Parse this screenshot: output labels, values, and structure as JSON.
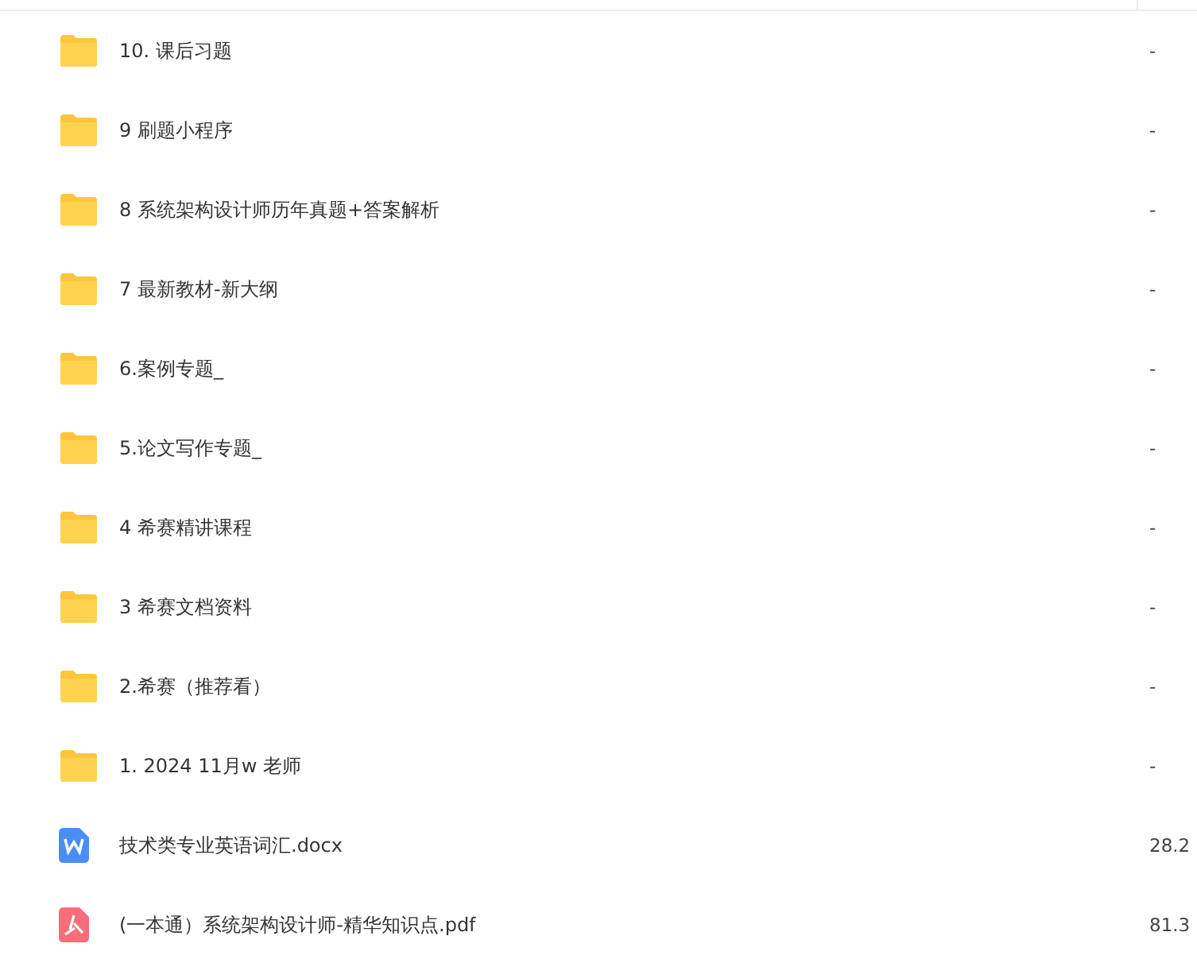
{
  "files": [
    {
      "kind": "folder",
      "name": "10. 课后习题",
      "size": "-"
    },
    {
      "kind": "folder",
      "name": "9 刷题小程序",
      "size": "-"
    },
    {
      "kind": "folder",
      "name": "8 系统架构设计师历年真题+答案解析",
      "size": "-"
    },
    {
      "kind": "folder",
      "name": "7 最新教材-新大纲",
      "size": "-"
    },
    {
      "kind": "folder",
      "name": "6.案例专题_",
      "size": "-"
    },
    {
      "kind": "folder",
      "name": "5.论文写作专题_",
      "size": "-"
    },
    {
      "kind": "folder",
      "name": "4 希赛精讲课程",
      "size": "-"
    },
    {
      "kind": "folder",
      "name": "3 希赛文档资料",
      "size": "-"
    },
    {
      "kind": "folder",
      "name": "2.希赛（推荐看）",
      "size": "-"
    },
    {
      "kind": "folder",
      "name": "1. 2024 11月w 老师",
      "size": "-"
    },
    {
      "kind": "word",
      "name": "技术类专业英语词汇.docx",
      "size": "28.2"
    },
    {
      "kind": "pdf",
      "name": "(一本通）系统架构设计师-精华知识点.pdf",
      "size": "81.3"
    }
  ]
}
